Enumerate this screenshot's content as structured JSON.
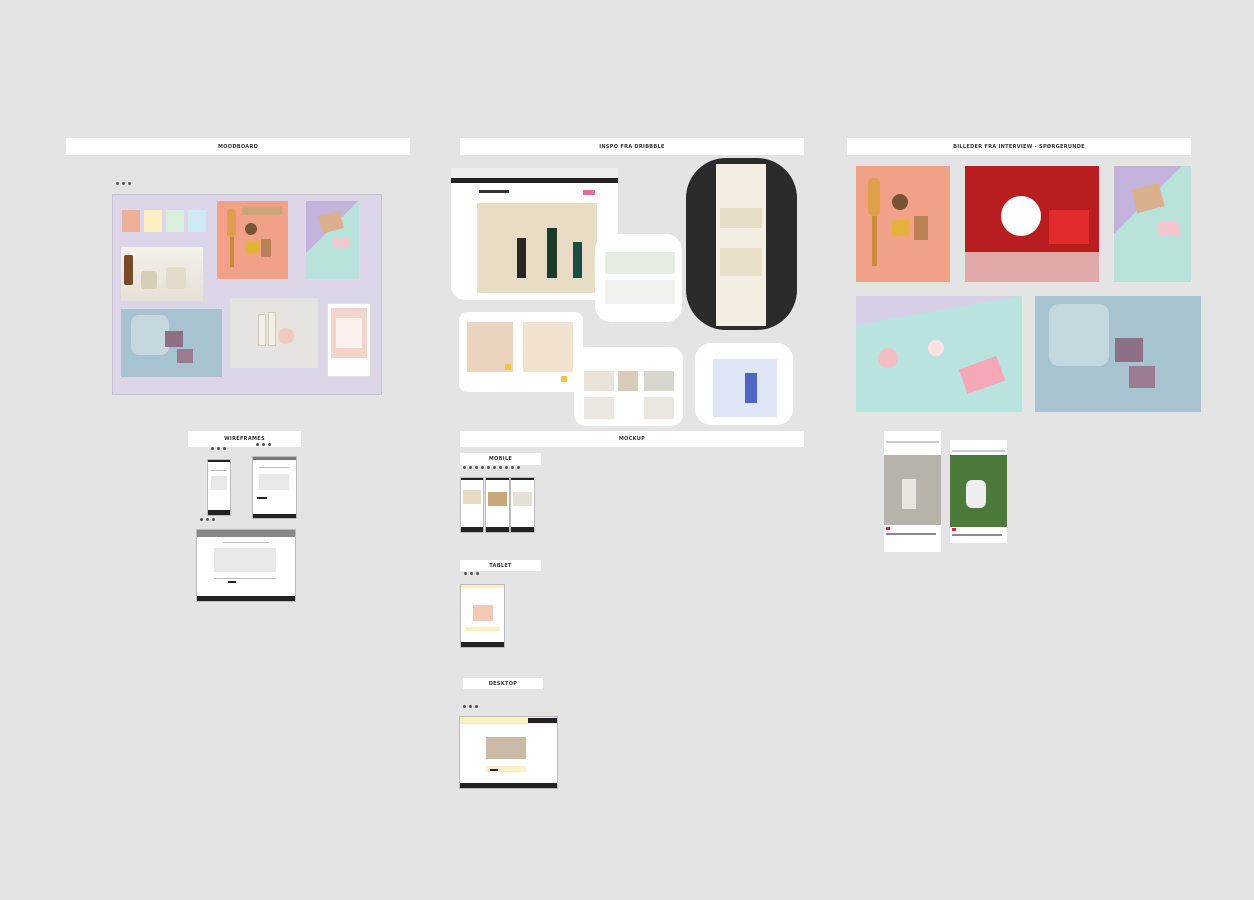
{
  "sections": {
    "moodboard": "MOODBOARD",
    "inspo": "INSPO FRA DRIBBBLE",
    "interview": "BILLEDER FRA INTERVIEW - SPØRGERUNDE",
    "wireframes": "WIREFRAMES",
    "mockup": "MOCKUP",
    "mobile": "MOBILE",
    "tablet": "TABLET",
    "desktop": "DESKTOP"
  },
  "colors": {
    "canvas": "#e4e4e4",
    "moodboard_bg": "#dcd6e8",
    "swatch_peach": "#efaf95",
    "swatch_cream": "#fbefc4",
    "swatch_mint": "#d9f0df",
    "swatch_sky": "#cfeaf2",
    "accent_pink": "#e2709a"
  },
  "icons": [
    "more-dots-icon"
  ]
}
